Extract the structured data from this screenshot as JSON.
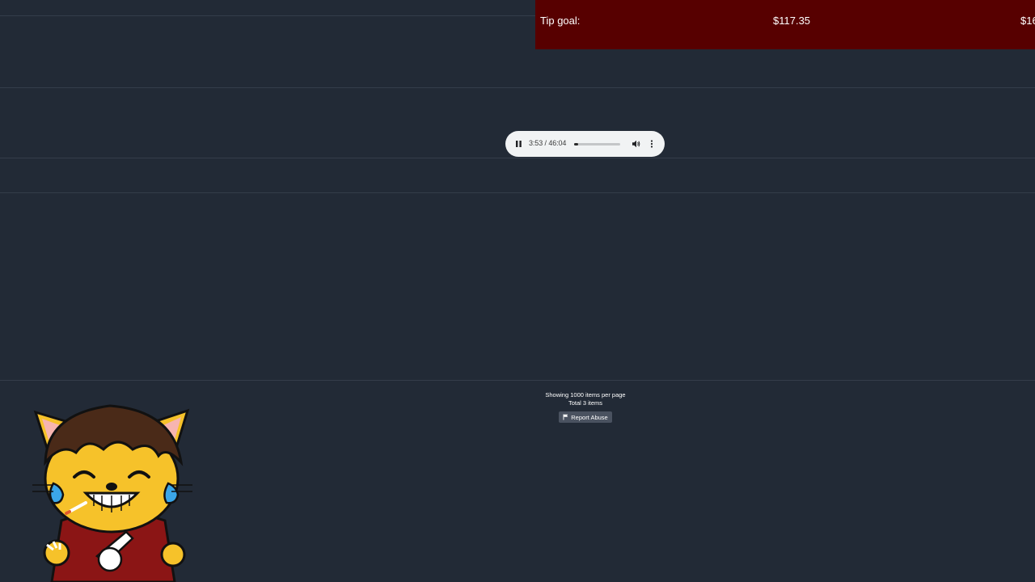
{
  "tip_goal": {
    "label": "Tip goal:",
    "current": "$117.35",
    "target_partial": "$16"
  },
  "audio_player": {
    "time_display": "3:53 / 46:04",
    "progress_fraction": 0.084,
    "icons": {
      "play_pause": "pause-icon",
      "volume": "volume-icon",
      "more": "more-vert-icon"
    }
  },
  "footer": {
    "items_per_page": "Showing 1000 items per page",
    "total_items": "Total 3 items",
    "report_label": "Report Abuse"
  },
  "colors": {
    "background": "#222a36",
    "tip_banner": "#570000",
    "player_bg": "#f1f3f4",
    "report_button": "#4a5260"
  }
}
